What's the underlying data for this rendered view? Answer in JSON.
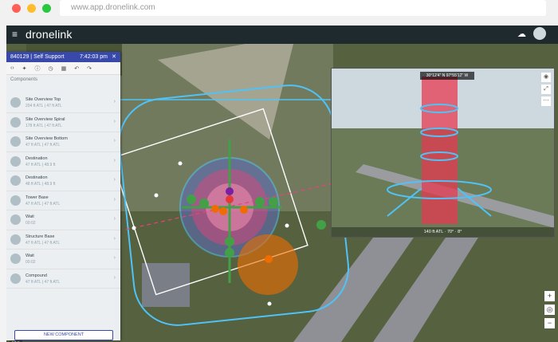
{
  "browser": {
    "url": "www.app.dronelink.com"
  },
  "app": {
    "brand": "dronelink"
  },
  "panel": {
    "mission": "840129 | Self Support",
    "time": "7:42:03 pm",
    "section": "Components",
    "new_component": "NEW COMPONENT",
    "items": [
      {
        "title": "Site Overview Top",
        "sub": "204 ft ATL | 47 ft ATL"
      },
      {
        "title": "Site Overview Spiral",
        "sub": "178 ft ATL | 47 ft ATL"
      },
      {
        "title": "Site Overview Bottom",
        "sub": "47 ft ATL | 47 ft ATL"
      },
      {
        "title": "Destination",
        "sub": "47 ft ATL | 48.9 ft"
      },
      {
        "title": "Destination",
        "sub": "48 ft ATL | 48.9 ft"
      },
      {
        "title": "Tower Base",
        "sub": "47 ft ATL | 47 ft ATL"
      },
      {
        "title": "Wait",
        "sub": "00:02"
      },
      {
        "title": "Structure Base",
        "sub": "47 ft ATL | 47 ft ATL"
      },
      {
        "title": "Wait",
        "sub": "00:02"
      },
      {
        "title": "Compound",
        "sub": "47 ft ATL | 47 ft ATL"
      }
    ]
  },
  "view3d": {
    "coords": "30°12'4\" N 97°55'12\" W",
    "status": "140 ft ATL  ·  70°  ·  8°"
  },
  "colors": {
    "accent": "#3949ab",
    "path": "#4fc3f7",
    "waypoint": "#43a047",
    "poi": "#f57c00"
  }
}
